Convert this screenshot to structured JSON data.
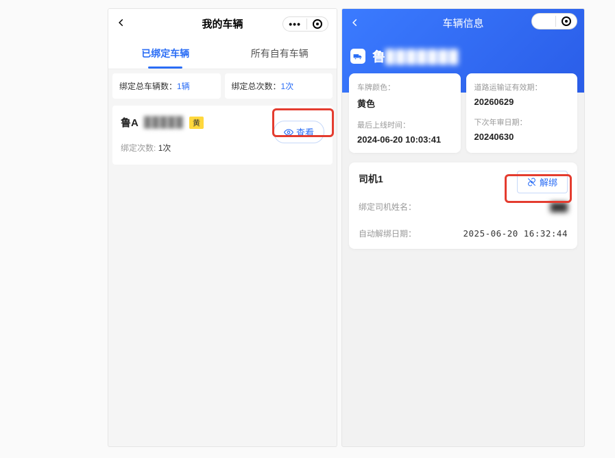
{
  "left": {
    "title": "我的车辆",
    "tabs": {
      "bound": "已绑定车辆",
      "own": "所有自有车辆"
    },
    "stats": {
      "total_label": "绑定总车辆数：",
      "total_value": "1辆",
      "times_label": "绑定总次数：",
      "times_value": "1次"
    },
    "vehicle": {
      "plate_prefix": "鲁A",
      "plate_hidden": "█████",
      "color_tag": "黄",
      "bind_times_label": "绑定次数:",
      "bind_times_value": "1次",
      "view_btn": "查看"
    }
  },
  "right": {
    "title": "车辆信息",
    "plate_prefix": "鲁",
    "plate_hidden": "███████",
    "info": {
      "card1": {
        "label1": "车牌颜色：",
        "value1": "黄色",
        "label2": "最后上线时间：",
        "value2": "2024-06-20 10:03:41"
      },
      "card2": {
        "label1": "道路运输证有效期：",
        "value1": "20260629",
        "label2": "下次年审日期：",
        "value2": "20240630"
      }
    },
    "driver": {
      "title": "司机1",
      "unbind_btn": "解绑",
      "name_label": "绑定司机姓名：",
      "name_value": "███",
      "auto_unbind_label": "自动解绑日期：",
      "auto_unbind_value": "2025-06-20 16:32:44"
    }
  }
}
